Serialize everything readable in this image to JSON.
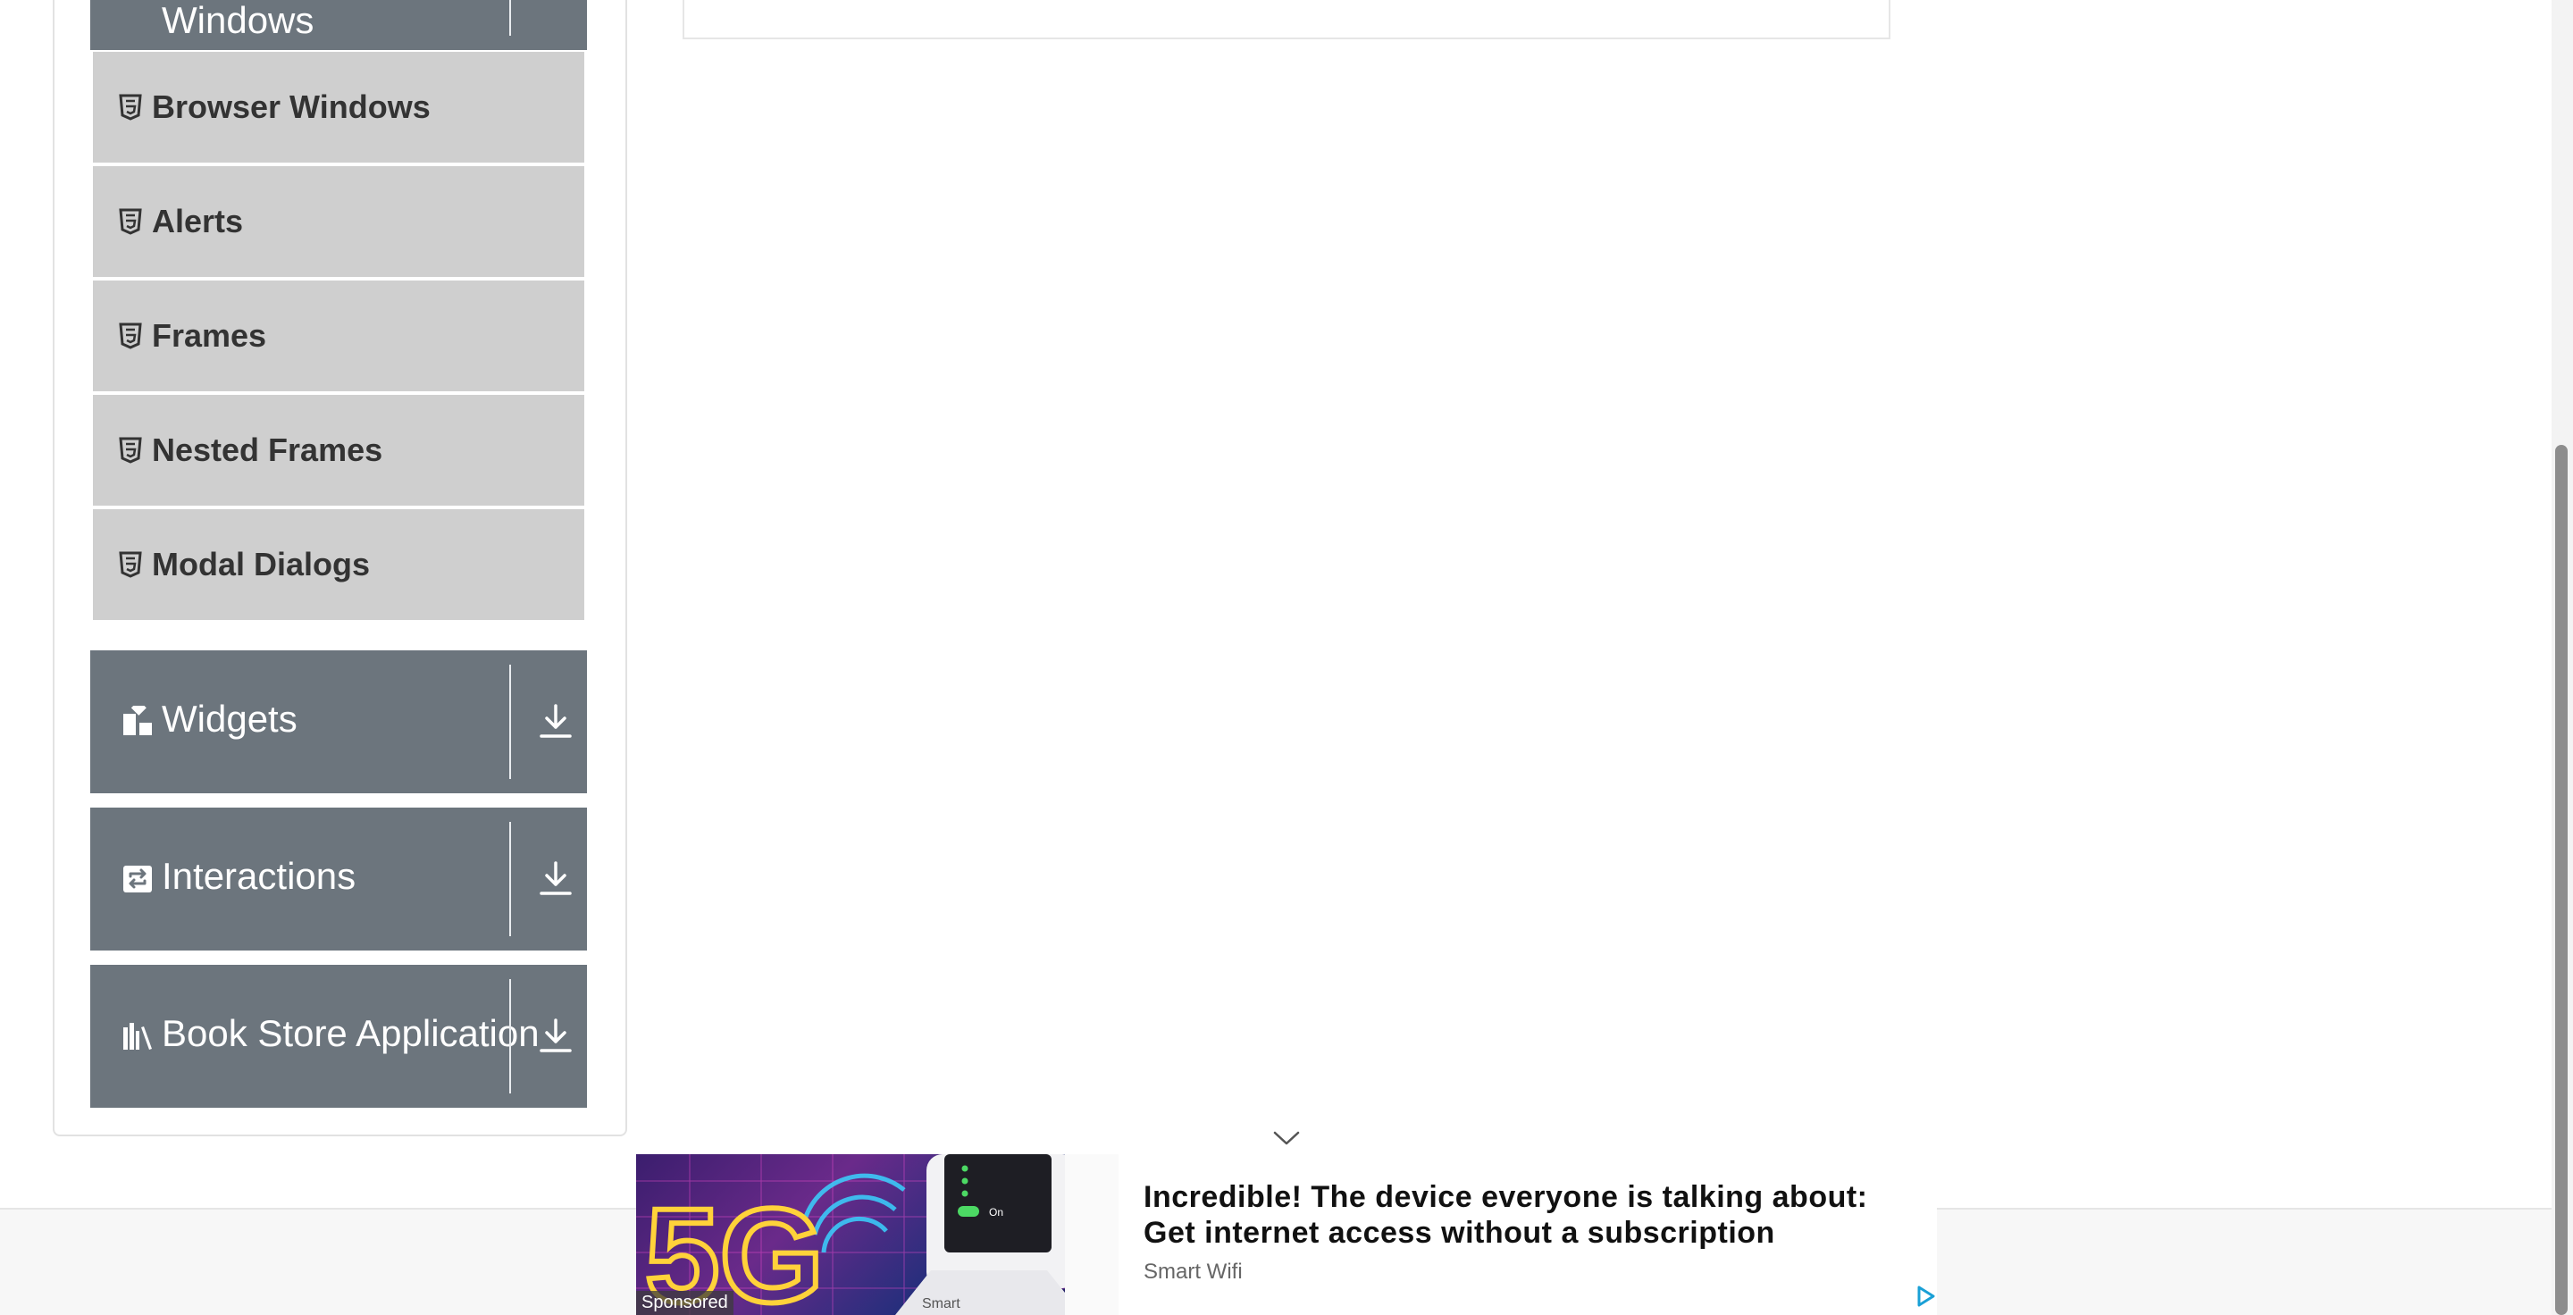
{
  "sidebar": {
    "top_group": {
      "label": "Windows",
      "icon": "file-icon"
    },
    "sub_items": [
      {
        "label": "Browser Windows",
        "icon": "html5-icon"
      },
      {
        "label": "Alerts",
        "icon": "html5-icon"
      },
      {
        "label": "Frames",
        "icon": "html5-icon"
      },
      {
        "label": "Nested Frames",
        "icon": "html5-icon"
      },
      {
        "label": "Modal Dialogs",
        "icon": "html5-icon"
      }
    ],
    "groups": [
      {
        "label": "Widgets",
        "icon": "widgets-icon"
      },
      {
        "label": "Interactions",
        "icon": "interactions-icon"
      },
      {
        "label": "Book Store Application",
        "icon": "books-icon"
      }
    ]
  },
  "ad": {
    "sponsored_label": "Sponsored",
    "title": "Incredible! The device everyone is talking about: Get internet access without a subscription",
    "source": "Smart Wifi",
    "image_text_big": "5G",
    "image_text_device": "Smart",
    "image_text_on": "On"
  },
  "colors": {
    "group_header_bg": "#6c757d",
    "sub_item_bg": "#cfcfcf",
    "sub_item_text": "#333333"
  }
}
